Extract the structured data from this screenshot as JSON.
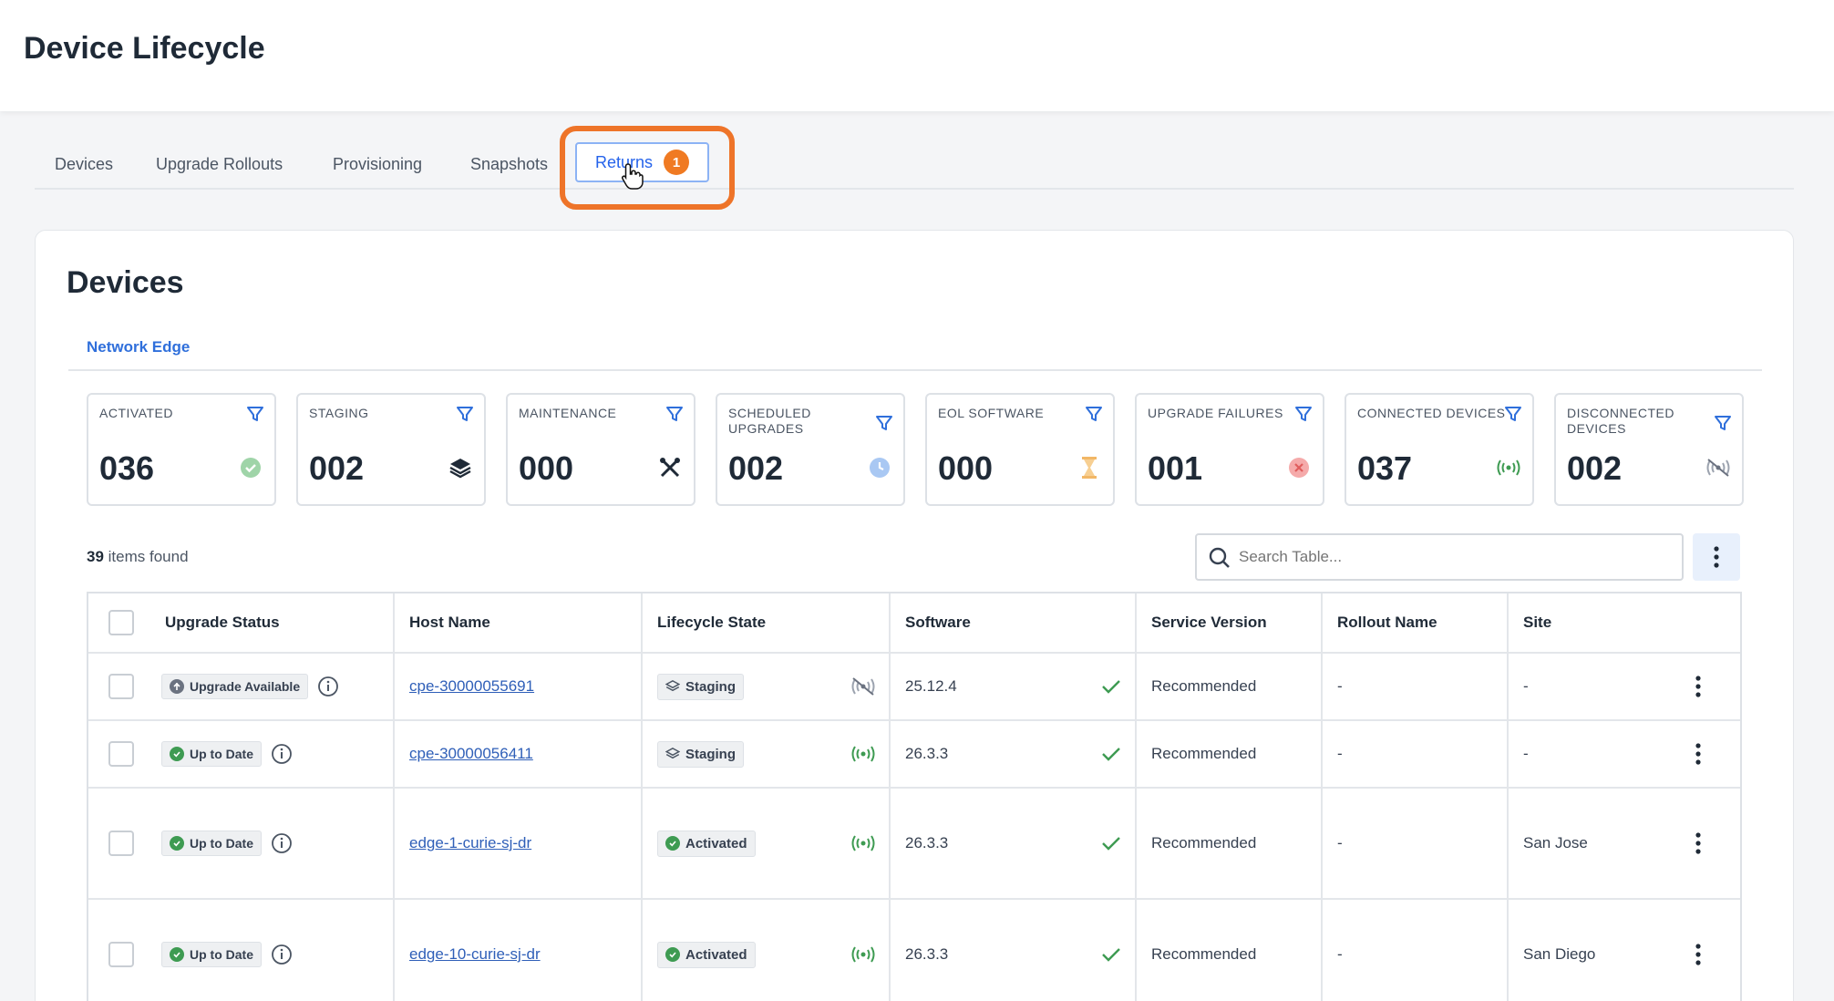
{
  "app": {
    "title": "Device Lifecycle"
  },
  "tabs": [
    {
      "label": "Devices"
    },
    {
      "label": "Upgrade Rollouts"
    },
    {
      "label": "Provisioning"
    },
    {
      "label": "Snapshots"
    },
    {
      "label": "Returns",
      "badge": "1",
      "active": true
    }
  ],
  "panel": {
    "title": "Devices",
    "subtab": "Network Edge"
  },
  "cards": [
    {
      "label": "ACTIVATED",
      "value": "036",
      "icon": "check-circle-icon",
      "color": "#7cc48a"
    },
    {
      "label": "STAGING",
      "value": "002",
      "icon": "layers-icon",
      "color": "#1f2a37"
    },
    {
      "label": "MAINTENANCE",
      "value": "000",
      "icon": "tools-icon",
      "color": "#1f2a37"
    },
    {
      "label": "SCHEDULED UPGRADES",
      "value": "002",
      "icon": "clock-icon",
      "color": "#8fb6f0"
    },
    {
      "label": "EOL SOFTWARE",
      "value": "000",
      "icon": "hourglass-icon",
      "color": "#f2b766"
    },
    {
      "label": "UPGRADE FAILURES",
      "value": "001",
      "icon": "error-circle-icon",
      "color": "#f08a8a"
    },
    {
      "label": "CONNECTED DEVICES",
      "value": "037",
      "icon": "signal-icon",
      "color": "#3e9b52"
    },
    {
      "label": "DISCONNECTED DEVICES",
      "value": "002",
      "icon": "signal-off-icon",
      "color": "#6b7280"
    }
  ],
  "results": {
    "count": "39",
    "suffix": "items found"
  },
  "search": {
    "placeholder": "Search Table..."
  },
  "table": {
    "columns": [
      "Upgrade Status",
      "Host Name",
      "Lifecycle State",
      "Software",
      "Service Version",
      "Rollout Name",
      "Site"
    ],
    "rows": [
      {
        "upgrade_status": "Upgrade Available",
        "status_kind": "available",
        "host": "cpe-30000055691",
        "state": "Staging",
        "connection": "disconnected",
        "software": "25.12.4",
        "service": "Recommended",
        "rollout": "-",
        "site": "-"
      },
      {
        "upgrade_status": "Up to Date",
        "status_kind": "uptodate",
        "host": "cpe-30000056411",
        "state": "Staging",
        "connection": "connected",
        "software": "26.3.3",
        "service": "Recommended",
        "rollout": "-",
        "site": "-"
      },
      {
        "upgrade_status": "Up to Date",
        "status_kind": "uptodate",
        "host": "edge-1-curie-sj-dr",
        "state": "Activated",
        "connection": "connected",
        "software": "26.3.3",
        "service": "Recommended",
        "rollout": "-",
        "site": "San Jose"
      },
      {
        "upgrade_status": "Up to Date",
        "status_kind": "uptodate",
        "host": "edge-10-curie-sj-dr",
        "state": "Activated",
        "connection": "connected",
        "software": "26.3.3",
        "service": "Recommended",
        "rollout": "-",
        "site": "San Diego"
      }
    ]
  }
}
